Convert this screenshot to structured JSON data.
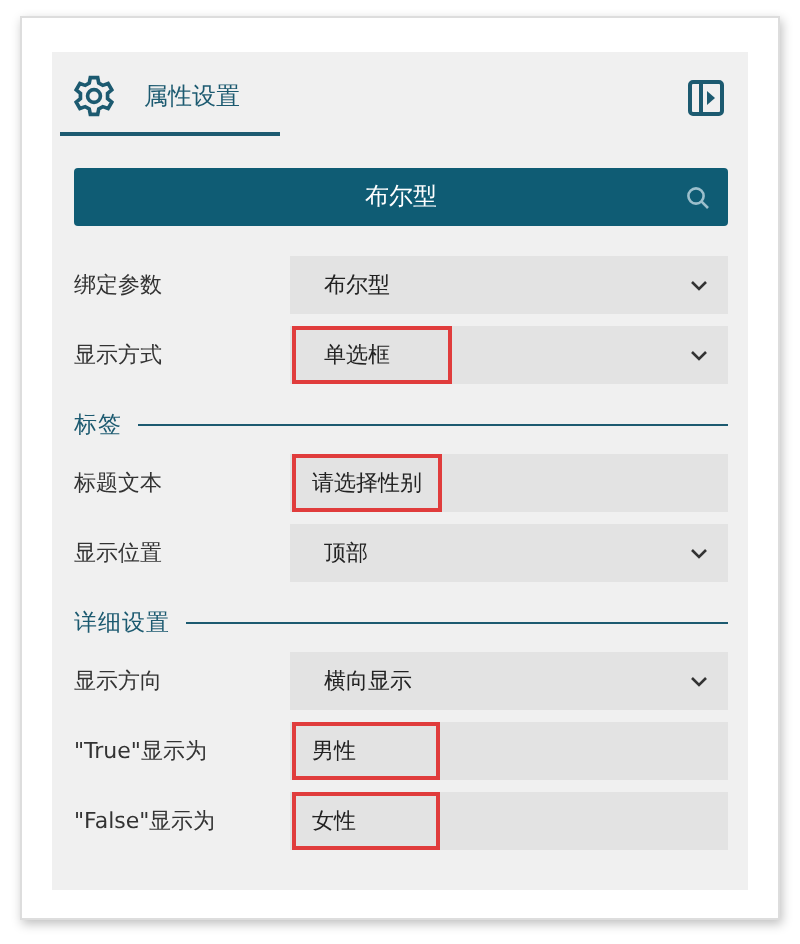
{
  "tab": {
    "label": "属性设置",
    "selected": true
  },
  "type_bar": {
    "value": "布尔型"
  },
  "sections": [
    {
      "rows": [
        {
          "label": "绑定参数",
          "kind": "select",
          "value": "布尔型",
          "highlighted": false
        },
        {
          "label": "显示方式",
          "kind": "select",
          "value": "单选框",
          "highlighted": true
        }
      ]
    },
    {
      "title": "标签",
      "rows": [
        {
          "label": "标题文本",
          "kind": "text",
          "value": "请选择性别",
          "highlighted": true
        },
        {
          "label": "显示位置",
          "kind": "select",
          "value": "顶部",
          "highlighted": false
        }
      ]
    },
    {
      "title": "详细设置",
      "rows": [
        {
          "label": "显示方向",
          "kind": "select",
          "value": "横向显示",
          "highlighted": false
        },
        {
          "label": "\"True\"显示为",
          "kind": "text",
          "value": "男性",
          "highlighted": true
        },
        {
          "label": "\"False\"显示为",
          "kind": "text",
          "value": "女性",
          "highlighted": true
        }
      ]
    }
  ]
}
